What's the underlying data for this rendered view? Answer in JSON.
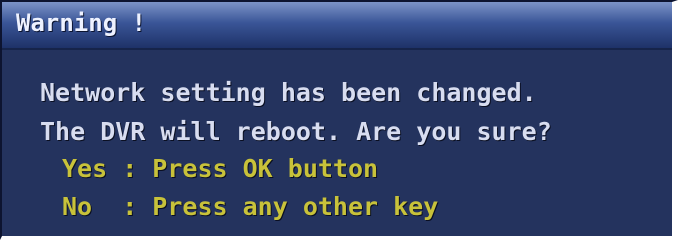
{
  "dialog": {
    "title": "Warning !",
    "message_line1": "Network setting has been changed.",
    "message_line2": "The DVR will reboot. Are you sure?",
    "option_yes": "Yes : Press OK button",
    "option_no": "No  : Press any other key"
  },
  "colors": {
    "background": "#24335e",
    "title_gradient_top": "#7c93c8",
    "title_gradient_bottom": "#1e3268",
    "message_text": "#d8ddf0",
    "option_text": "#c8c23a"
  }
}
